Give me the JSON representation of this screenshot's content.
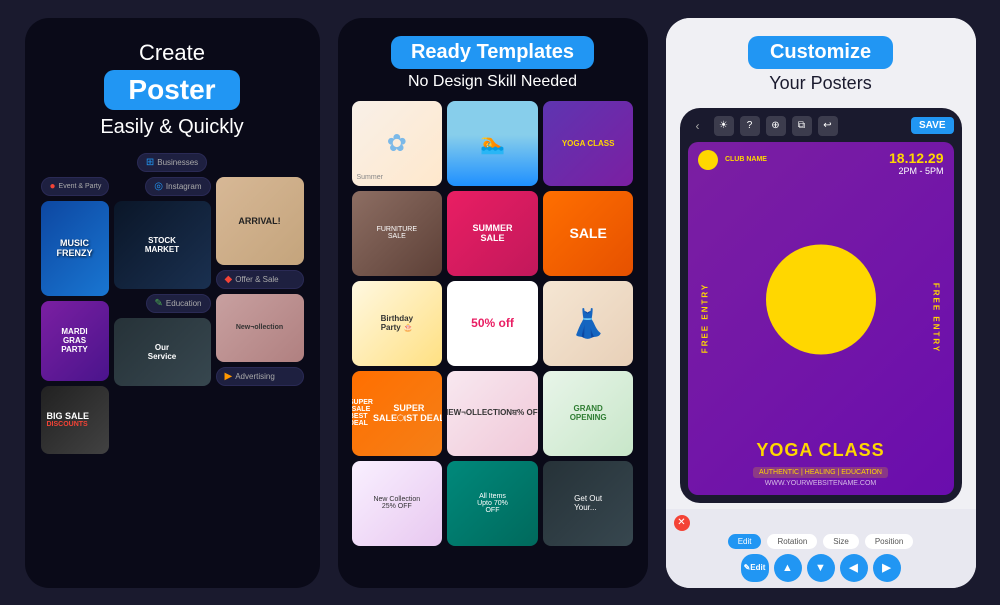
{
  "left_panel": {
    "create_label": "Create",
    "poster_label": "Poster",
    "tagline": "Easily & Quickly",
    "categories": [
      {
        "name": "Businesses",
        "color": "blue"
      },
      {
        "name": "Event & Party",
        "color": "red"
      },
      {
        "name": "Instagram",
        "color": "blue"
      },
      {
        "name": "Education",
        "color": "green"
      },
      {
        "name": "Offer & Sale",
        "color": "red"
      },
      {
        "name": "Advertising",
        "color": "orange"
      }
    ],
    "thumbnails": [
      {
        "label": "MUSIC FRENZY",
        "style": "music"
      },
      {
        "label": "STOCK MARKET",
        "style": "stock"
      },
      {
        "label": "MARDI GRAS PARTY",
        "style": "mardi"
      },
      {
        "label": "New Collection",
        "style": "newcol"
      },
      {
        "label": "ARRIVAL!",
        "style": "arrival"
      },
      {
        "label": "BIG SALE",
        "style": "bigsale"
      }
    ]
  },
  "middle_panel": {
    "title": "Ready Templates",
    "subtitle": "No Design Skill Needed",
    "templates": [
      {
        "label": "Flower",
        "style": "flower"
      },
      {
        "label": "Swim",
        "style": "swim"
      },
      {
        "label": "YOGA CLASS",
        "style": "yoga"
      },
      {
        "label": "Furniture Sale",
        "style": "furniture"
      },
      {
        "label": "SUMMER SALE",
        "style": "summer"
      },
      {
        "label": "SALE",
        "style": "sale"
      },
      {
        "label": "Birthday Party",
        "style": "birthday"
      },
      {
        "label": "50% off",
        "style": "50off"
      },
      {
        "label": "Model",
        "style": "model"
      },
      {
        "label": "NEW COLLECTION 25% OFF",
        "style": "newcol2"
      },
      {
        "label": "SUPER SALE BEST DEAL",
        "style": "supersale"
      },
      {
        "label": "GRAND OPENING",
        "style": "grand"
      },
      {
        "label": "New Collection 25% OFF",
        "style": "newcol3"
      },
      {
        "label": "All Items Upto 70% OFF",
        "style": "allitems"
      },
      {
        "label": "Get Out Your",
        "style": "getout"
      }
    ]
  },
  "right_panel": {
    "customize_label": "Customize",
    "your_posters_label": "Your Posters",
    "save_label": "SAVE",
    "poster": {
      "club_name": "CLUB NAME",
      "date": "18.12.29",
      "time": "2PM - 5PM",
      "free_entry": "FREE ENTRY",
      "title": "YOGA CLASS",
      "subtitle": "AUTHENTIC | HEALING | EDUCATION",
      "website": "WWW.YOURWEBSITENAME.COM"
    },
    "toolbar_icons": [
      "back",
      "share",
      "help",
      "layers",
      "copy",
      "undo",
      "save"
    ],
    "bottom_tabs": [
      "Edit",
      "Position",
      "Size",
      "Position"
    ],
    "bottom_actions": [
      "Edit",
      "▲",
      "▼",
      "◀",
      "▶"
    ]
  }
}
